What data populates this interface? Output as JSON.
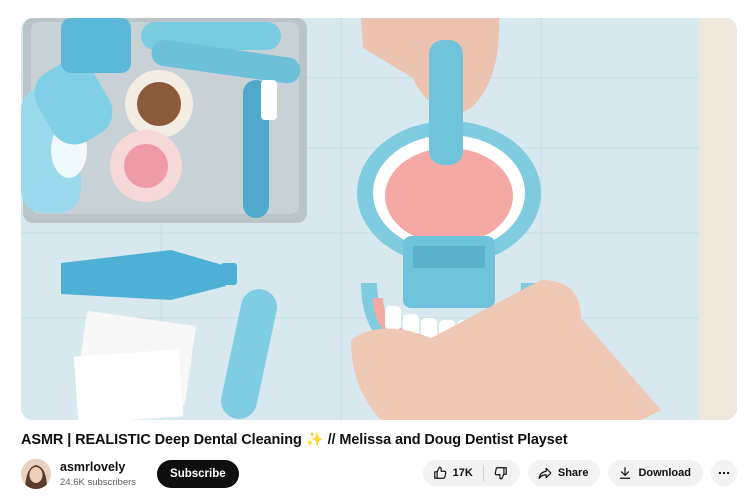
{
  "video": {
    "title": "ASMR | REALISTIC Deep Dental Cleaning",
    "title_emoji": "✨",
    "title_suffix": "// Melissa and Doug Dentist Playset"
  },
  "channel": {
    "name": "asmrlovely",
    "subscribers": "24.6K subscribers",
    "subscribe_label": "Subscribe"
  },
  "actions": {
    "like_count": "17K",
    "share_label": "Share",
    "download_label": "Download",
    "more_icon": "more-horizontal-icon"
  },
  "colors": {
    "toy_blue": "#6cc7dd",
    "toy_pink": "#f4a5a0",
    "subscribe_bg": "#0f0f0f",
    "action_pill_bg": "#f2f2f2"
  }
}
